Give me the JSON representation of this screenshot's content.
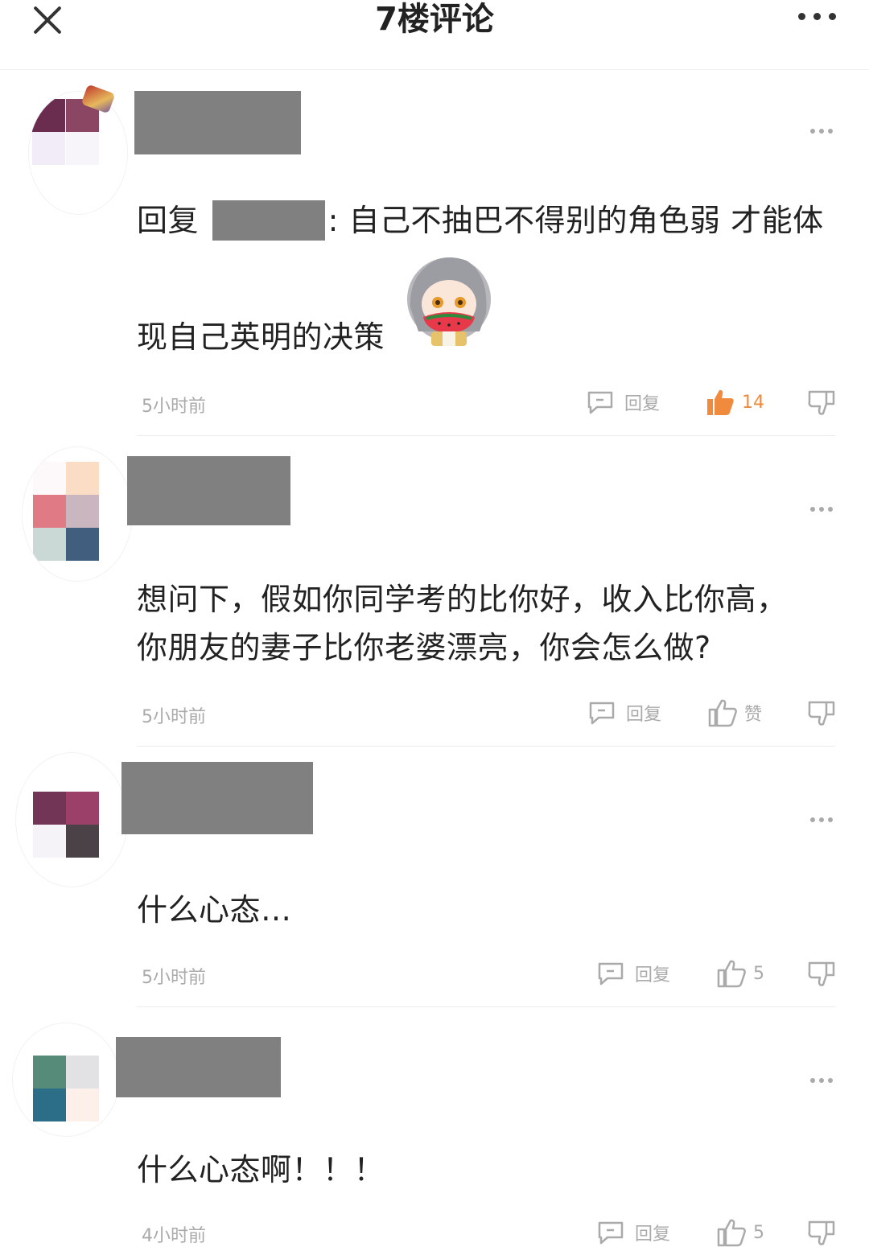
{
  "header": {
    "title": "7楼评论",
    "close_icon": "close-icon",
    "more_icon": "more-icon"
  },
  "comments": [
    {
      "reply_prefix": "回复",
      "colon": ":",
      "text_line1": "自己不抽巴不得别的角色弱 才能体",
      "text_line2": "现自己英明的决策",
      "sticker": "anime-girl-eating-watermelon-sticker",
      "time": "5小时前",
      "reply_label": "回复",
      "like_label": "14",
      "like_active": true,
      "avatar_colors": [
        "#6b2d4f",
        "#8b4663",
        "#f1ecf7",
        "#f7f5fa"
      ]
    },
    {
      "text_line1": "想问下，假如你同学考的比你好，收入比你高，",
      "text_line2": "你朋友的妻子比你老婆漂亮，你会怎么做?",
      "time": "5小时前",
      "reply_label": "回复",
      "like_label": "赞",
      "avatar_colors": [
        "#fdf9fa",
        "#fbdcc5",
        "#e07a84",
        "#c9b6bf",
        "#cbd9d6",
        "#425e7e"
      ]
    },
    {
      "text_line1": "什么心态…",
      "time": "5小时前",
      "reply_label": "回复",
      "like_label": "5",
      "avatar_colors": [
        "#733555",
        "#9b4068",
        "#f5f3f7",
        "#4a4247"
      ]
    },
    {
      "text_line1": "什么心态啊！！！",
      "time": "4小时前",
      "reply_label": "回复",
      "like_label": "5",
      "avatar_colors": [
        "#568b79",
        "#e2e2e4",
        "#2c6d88",
        "#fdefe9"
      ]
    }
  ],
  "colors": {
    "accent_orange": "#f08a3c",
    "muted_gray": "#aaaaaa",
    "name_redaction": "#808080"
  }
}
